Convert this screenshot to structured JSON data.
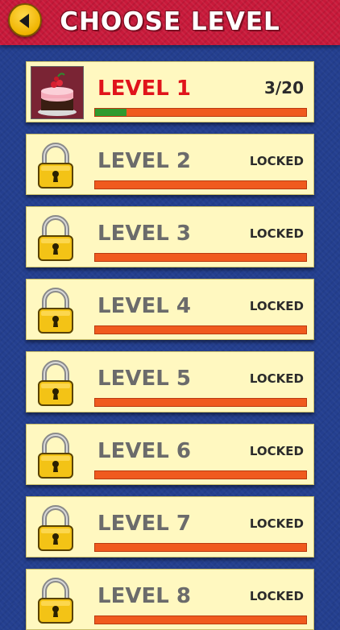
{
  "header": {
    "title": "CHOOSE LEVEL"
  },
  "levels": [
    {
      "name": "LEVEL 1",
      "status": "3/20",
      "locked": false,
      "progress": 0.15
    },
    {
      "name": "LEVEL 2",
      "status": "LOCKED",
      "locked": true,
      "progress": 0
    },
    {
      "name": "LEVEL 3",
      "status": "LOCKED",
      "locked": true,
      "progress": 0
    },
    {
      "name": "LEVEL 4",
      "status": "LOCKED",
      "locked": true,
      "progress": 0
    },
    {
      "name": "LEVEL 5",
      "status": "LOCKED",
      "locked": true,
      "progress": 0
    },
    {
      "name": "LEVEL 6",
      "status": "LOCKED",
      "locked": true,
      "progress": 0
    },
    {
      "name": "LEVEL 7",
      "status": "LOCKED",
      "locked": true,
      "progress": 0
    },
    {
      "name": "LEVEL 8",
      "status": "LOCKED",
      "locked": true,
      "progress": 0
    }
  ],
  "colors": {
    "header": "#c8193a",
    "background": "#243f8f",
    "card": "#fff8c0",
    "progress_track": "#f05a1e",
    "progress_fill": "#2e9a2e",
    "unlocked_name": "#e0141b",
    "locked_name": "#6b6b6b"
  },
  "icons": {
    "back": "back-arrow-icon",
    "lock": "padlock-icon",
    "thumbnail": "cake-thumbnail"
  }
}
